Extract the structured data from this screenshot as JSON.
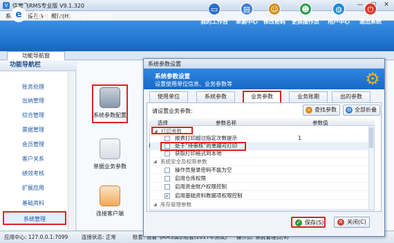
{
  "window": {
    "title": "信管飞RMS专业版 V9.1.320",
    "app_icon": "V",
    "min": "—",
    "max": "□",
    "close": "✕"
  },
  "menu": {
    "items": [
      "系统(S)",
      "设置(W)",
      "帮助(H)"
    ]
  },
  "banner": {
    "logo_mark": "e",
    "logo_text": "信管飞",
    "slogan": "精细化管理软件",
    "buttons": [
      {
        "label": "我的工作台",
        "icon": "monitor-icon",
        "glyph": "▭",
        "color": "#2a70c8"
      },
      {
        "label": "单据中心",
        "icon": "document-icon",
        "glyph": "▤",
        "color": "#3d7dd0"
      },
      {
        "label": "修改密码",
        "icon": "key-user-icon",
        "glyph": "☺",
        "color": "#d08b1e"
      },
      {
        "label": "更换操作员",
        "icon": "users-icon",
        "glyph": "☻",
        "color": "#2a9b4a"
      },
      {
        "label": "用户中心",
        "icon": "globe-icon",
        "glyph": "◍",
        "color": "#1f8bd6"
      },
      {
        "label": "退出系统",
        "icon": "power-icon",
        "glyph": "⏻",
        "color": "#d93a2b"
      }
    ]
  },
  "nav_tab": {
    "label": "功能导航窗"
  },
  "sidebar": {
    "title": "功能导航栏",
    "items": [
      {
        "label": "账务处理"
      },
      {
        "label": "出纳管理"
      },
      {
        "label": "综合管理"
      },
      {
        "label": "票据管理"
      },
      {
        "label": "会员管理"
      },
      {
        "label": "客户关系"
      },
      {
        "label": "绩效考核"
      },
      {
        "label": "扩展应用"
      },
      {
        "label": "基础资料"
      },
      {
        "label": "系统管理"
      }
    ]
  },
  "content": {
    "launchers": [
      {
        "label": "系统参数配置",
        "icon": "database-settings-icon"
      },
      {
        "label": "单据业务参数",
        "icon": "gear-document-icon"
      },
      {
        "label": "连接客户端",
        "icon": "network-icon"
      }
    ]
  },
  "dialog": {
    "title": "系统参数设置",
    "header_title": "系统参数设置",
    "header_subtitle": "设置使用单位信息、业务参数等",
    "tabs": [
      "使用单位",
      "系统参数",
      "业务参数",
      "业务账期",
      "出的参数"
    ],
    "prompt": "请设置业务参数:",
    "find_button": "查找参数",
    "collapse_button": "全部折叠",
    "grid": {
      "headers": [
        "选择",
        "参数名称",
        "参数值"
      ],
      "rows": [
        {
          "type": "group",
          "text": "打印参数"
        },
        {
          "type": "item",
          "text": "报表打印超过指定次数提示",
          "checked": false,
          "value": "1"
        },
        {
          "type": "item",
          "text": "处于“待审核”的单据可打印",
          "checked": false,
          "value": ""
        },
        {
          "type": "item",
          "text": "获取打印格式到本地",
          "checked": false,
          "value": ""
        },
        {
          "type": "group",
          "text": "系统安全及权限参数"
        },
        {
          "type": "item",
          "text": "操作员登录密码不能为空",
          "checked": false,
          "value": ""
        },
        {
          "type": "item",
          "text": "启用仓库权限",
          "checked": false,
          "value": ""
        },
        {
          "type": "item",
          "text": "启用资金账户权限控制",
          "checked": false,
          "value": ""
        },
        {
          "type": "item",
          "text": "启用基础资料数据项权限控制",
          "checked": true,
          "value": ""
        },
        {
          "type": "group",
          "text": "库存管理参数"
        }
      ]
    },
    "save_button": "保存(S)",
    "close_button": "关闭(C)"
  },
  "statusbar": {
    "items": [
      "应用中心: 127.0.0.1:7099",
      "连接状态: 正常",
      "账套: 信管飞RMS演示账套(2017年测试)",
      "操作员: 系统管理员(9)"
    ]
  },
  "colors": {
    "accent": "#1769c7",
    "highlight": "#e02020"
  }
}
